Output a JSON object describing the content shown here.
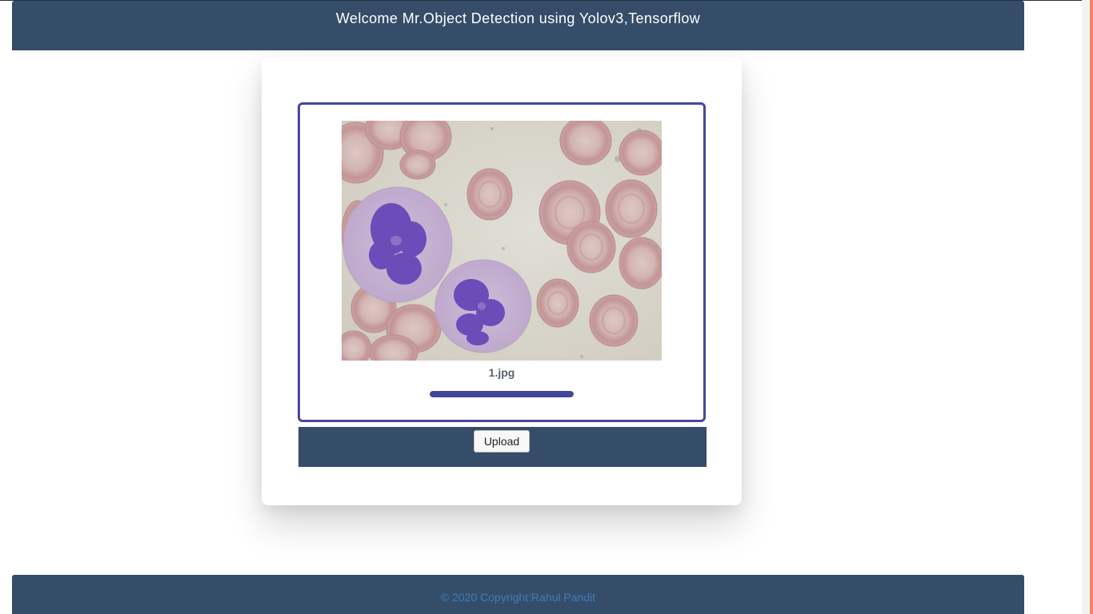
{
  "header": {
    "title": "Welcome Mr.Object Detection using Yolov3,Tensorflow"
  },
  "upload": {
    "file_name": "1.jpg",
    "progress_percent": 100,
    "button_label": "Upload",
    "preview_icon": "microscope-blood-cell-image"
  },
  "footer": {
    "copyright": "© 2020 Copyright:Rahul Pandit"
  },
  "colors": {
    "header_bg": "#354d68",
    "box_border": "#46479a",
    "progress": "#40469a",
    "footer_text": "#3c7dbf",
    "accent_strip": "#ee8a5f"
  }
}
